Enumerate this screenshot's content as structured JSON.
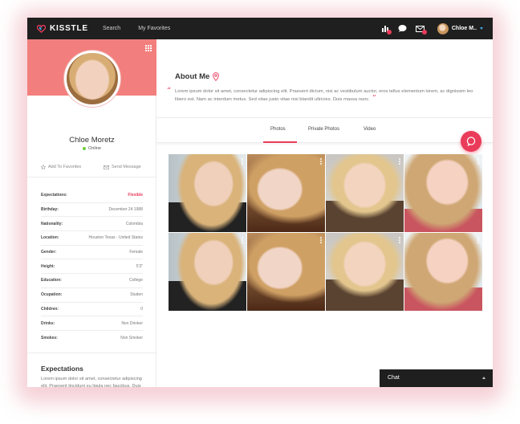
{
  "topbar": {
    "brand": "KISSTLE",
    "nav": [
      "Search",
      "My Favorites"
    ],
    "icons": [
      "stats-icon",
      "chat-bubble-icon",
      "mail-icon"
    ],
    "username": "Chloe M.."
  },
  "profile": {
    "name": "Chloe Moretz",
    "status": "Online",
    "actions": {
      "favorite": "Add To Favorites",
      "message": "Send Message"
    },
    "details": [
      {
        "label": "Expectations:",
        "value": "Flexible",
        "accent": true
      },
      {
        "label": "Birthday:",
        "value": "December 24 1988"
      },
      {
        "label": "Nationality:",
        "value": "Colombia"
      },
      {
        "label": "Location:",
        "value": "Houston Texas - United States"
      },
      {
        "label": "Gender:",
        "value": "Female"
      },
      {
        "label": "Height:",
        "value": "5'3\""
      },
      {
        "label": "Education:",
        "value": "College"
      },
      {
        "label": "Ocupation:",
        "value": "Studen"
      },
      {
        "label": "Children:",
        "value": "0"
      },
      {
        "label": "Drinks:",
        "value": "Non Drinker"
      },
      {
        "label": "Smokes:",
        "value": "Non Smoker"
      }
    ],
    "expectations_title": "Expectations",
    "expectations_text": "Lorem ipsum dolor sit amet, consectetur adipiscing elit. Praesent tincidunt eu ligula nec faucibus. Duis eget nisi amet."
  },
  "about": {
    "title": "About Me",
    "text": "Lorem ipsum dolor sit amet, consectetur adipiscing elit. Praesent dictum, nisi ac vestibulum auctor, eros tellus elementum lorem, ac dignissim leo libero est. Nam ac interdum metus. Sed vitae justo vitae nisi blandit ultricies. Duis massa nunc."
  },
  "tabs": [
    "Photos",
    "Private Photos",
    "Video"
  ],
  "active_tab": "Photos",
  "photos": [
    "photo-1",
    "photo-2",
    "photo-3",
    "photo-4",
    "photo-5",
    "photo-6",
    "photo-7",
    "photo-8"
  ],
  "chat": {
    "label": "Chat"
  },
  "colors": {
    "accent": "#ea3b5a",
    "cover": "#f27f7d",
    "topbar": "#1f1f1f",
    "online": "#6ccf3c"
  }
}
